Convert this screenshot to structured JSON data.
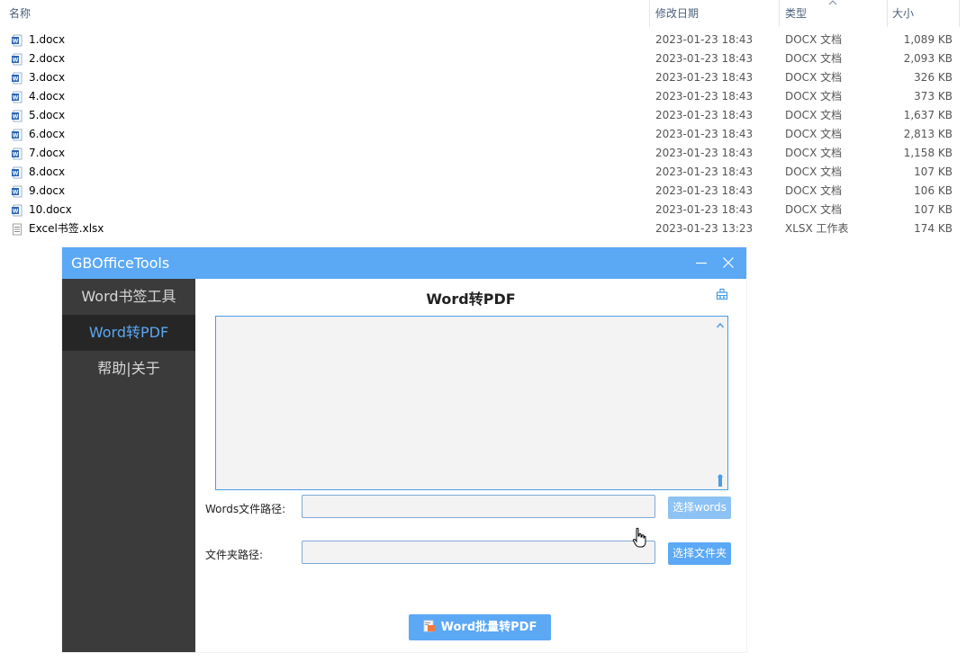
{
  "explorer": {
    "columns": {
      "name": "名称",
      "date": "修改日期",
      "type": "类型",
      "size": "大小"
    },
    "files": [
      {
        "name": "1.docx",
        "date": "2023-01-23 18:43",
        "type": "DOCX 文档",
        "size": "1,089 KB",
        "icon": "word-doc-icon"
      },
      {
        "name": "2.docx",
        "date": "2023-01-23 18:43",
        "type": "DOCX 文档",
        "size": "2,093 KB",
        "icon": "word-doc-icon"
      },
      {
        "name": "3.docx",
        "date": "2023-01-23 18:43",
        "type": "DOCX 文档",
        "size": "326 KB",
        "icon": "word-doc-icon"
      },
      {
        "name": "4.docx",
        "date": "2023-01-23 18:43",
        "type": "DOCX 文档",
        "size": "373 KB",
        "icon": "word-doc-icon"
      },
      {
        "name": "5.docx",
        "date": "2023-01-23 18:43",
        "type": "DOCX 文档",
        "size": "1,637 KB",
        "icon": "word-doc-icon"
      },
      {
        "name": "6.docx",
        "date": "2023-01-23 18:43",
        "type": "DOCX 文档",
        "size": "2,813 KB",
        "icon": "word-doc-icon"
      },
      {
        "name": "7.docx",
        "date": "2023-01-23 18:43",
        "type": "DOCX 文档",
        "size": "1,158 KB",
        "icon": "word-doc-icon"
      },
      {
        "name": "8.docx",
        "date": "2023-01-23 18:43",
        "type": "DOCX 文档",
        "size": "107 KB",
        "icon": "word-doc-icon"
      },
      {
        "name": "9.docx",
        "date": "2023-01-23 18:43",
        "type": "DOCX 文档",
        "size": "106 KB",
        "icon": "word-doc-icon"
      },
      {
        "name": "10.docx",
        "date": "2023-01-23 18:43",
        "type": "DOCX 文档",
        "size": "107 KB",
        "icon": "word-doc-icon"
      },
      {
        "name": "Excel书签.xlsx",
        "date": "2023-01-23 13:23",
        "type": "XLSX 工作表",
        "size": "174 KB",
        "icon": "generic-file-icon"
      }
    ]
  },
  "app": {
    "title": "GBOfficeTools",
    "nav": [
      {
        "label": "Word书签工具",
        "active": false
      },
      {
        "label": "Word转PDF",
        "active": true
      },
      {
        "label": "帮助|关于",
        "active": false
      }
    ],
    "content": {
      "title": "Word转PDF",
      "log_text": "",
      "words_path_label": "Words文件路径:",
      "words_path_value": "",
      "choose_words_button": "选择words",
      "folder_path_label": "文件夹路径:",
      "folder_path_value": "",
      "choose_folder_button": "选择文件夹",
      "convert_button": "Word批量转PDF"
    }
  },
  "colors": {
    "accent": "#5ba8f5",
    "sidebar_bg": "#3b3b3b",
    "sidebar_active_bg": "#262626",
    "active_text": "#5aa7f2"
  }
}
